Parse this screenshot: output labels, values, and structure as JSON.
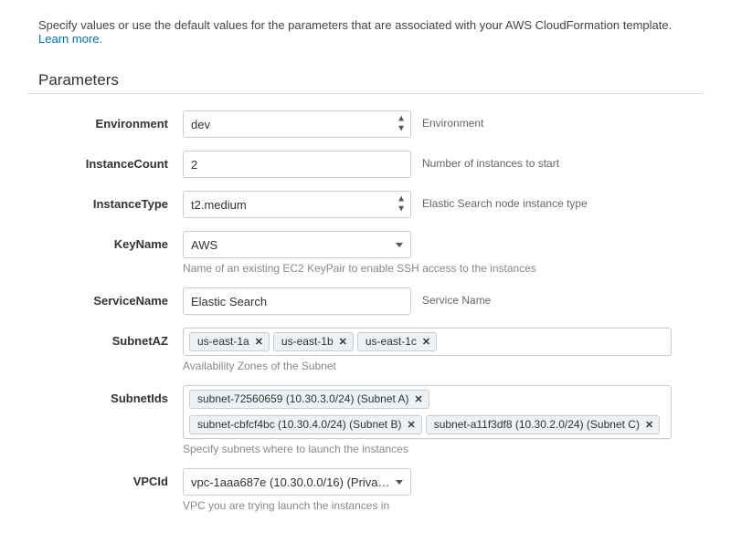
{
  "intro": {
    "text": "Specify values or use the default values for the parameters that are associated with your AWS CloudFormation template. ",
    "link": "Learn more."
  },
  "section_title": "Parameters",
  "params": {
    "environment": {
      "label": "Environment",
      "value": "dev",
      "desc": "Environment"
    },
    "instance_count": {
      "label": "InstanceCount",
      "value": "2",
      "desc": "Number of instances to start"
    },
    "instance_type": {
      "label": "InstanceType",
      "value": "t2.medium",
      "desc": "Elastic Search node instance type"
    },
    "key_name": {
      "label": "KeyName",
      "value": "AWS",
      "desc": "Name of an existing EC2 KeyPair to enable SSH access to the instances"
    },
    "service_name": {
      "label": "ServiceName",
      "value": "Elastic Search",
      "desc": "Service Name"
    },
    "subnet_az": {
      "label": "SubnetAZ",
      "tags": [
        "us-east-1a",
        "us-east-1b",
        "us-east-1c"
      ],
      "desc": "Availability Zones of the Subnet"
    },
    "subnet_ids": {
      "label": "SubnetIds",
      "tags": [
        "subnet-72560659 (10.30.3.0/24) (Subnet A)",
        "subnet-cbfcf4bc (10.30.4.0/24) (Subnet B)",
        "subnet-a11f3df8 (10.30.2.0/24) (Subnet C)"
      ],
      "desc": "Specify subnets where to launch the instances"
    },
    "vpc_id": {
      "label": "VPCId",
      "value": "vpc-1aaa687e (10.30.0.0/16) (Private V...",
      "desc": "VPC you are trying launch the instances in"
    }
  }
}
